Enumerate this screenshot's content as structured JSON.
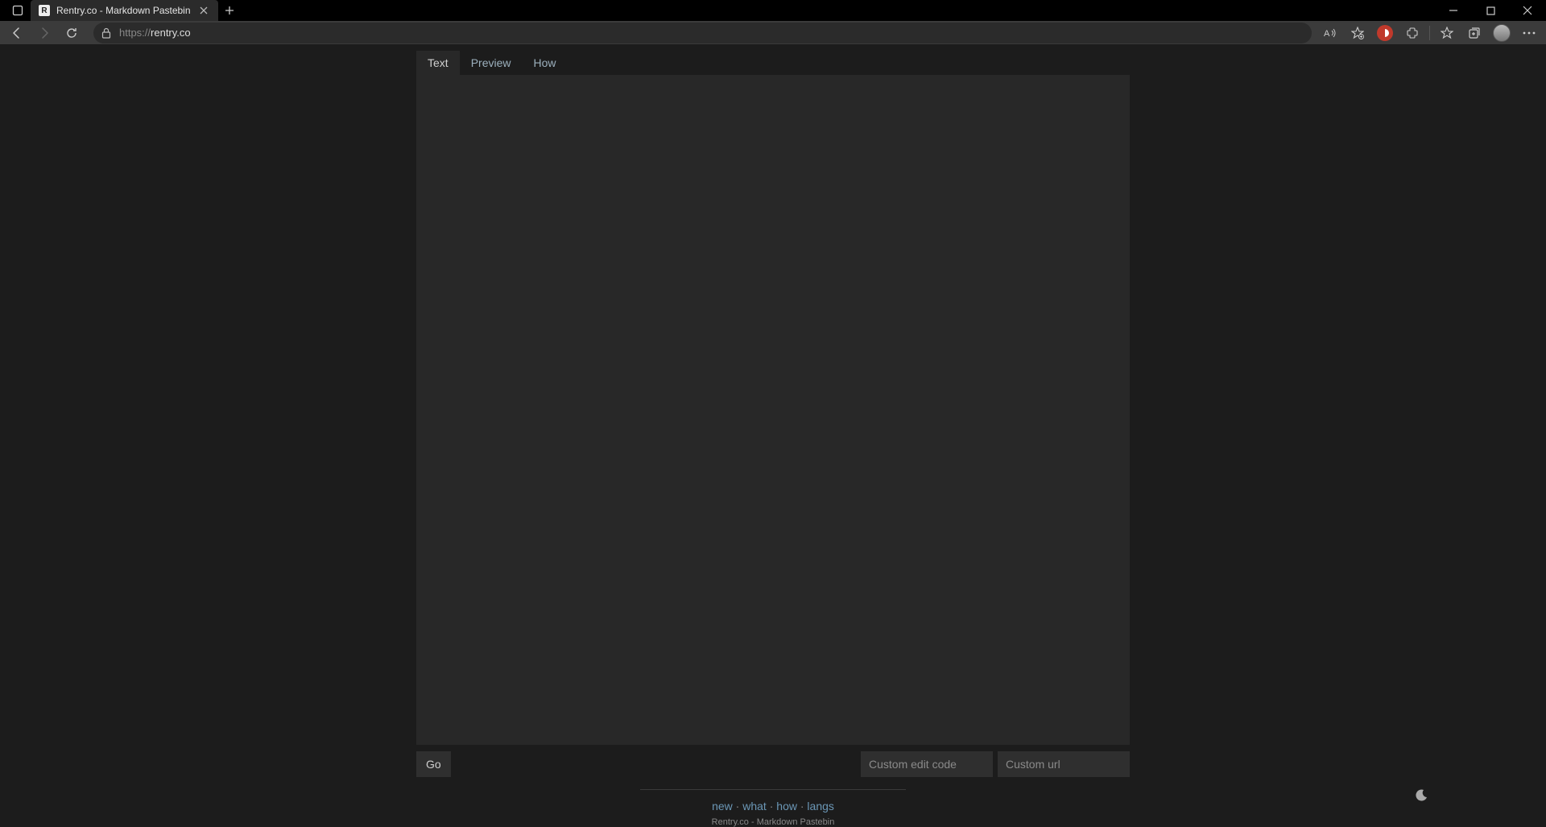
{
  "browser": {
    "tab_title": "Rentry.co - Markdown Pastebin",
    "url_prefix": "https://",
    "url_host": "rentry.co"
  },
  "app": {
    "tabs": {
      "text": "Text",
      "preview": "Preview",
      "how": "How"
    },
    "go_label": "Go",
    "edit_code_placeholder": "Custom edit code",
    "custom_url_placeholder": "Custom url",
    "footer_links": {
      "new": "new",
      "what": "what",
      "how": "how",
      "langs": "langs",
      "sep": " · "
    },
    "tagline": "Rentry.co - Markdown Pastebin"
  }
}
